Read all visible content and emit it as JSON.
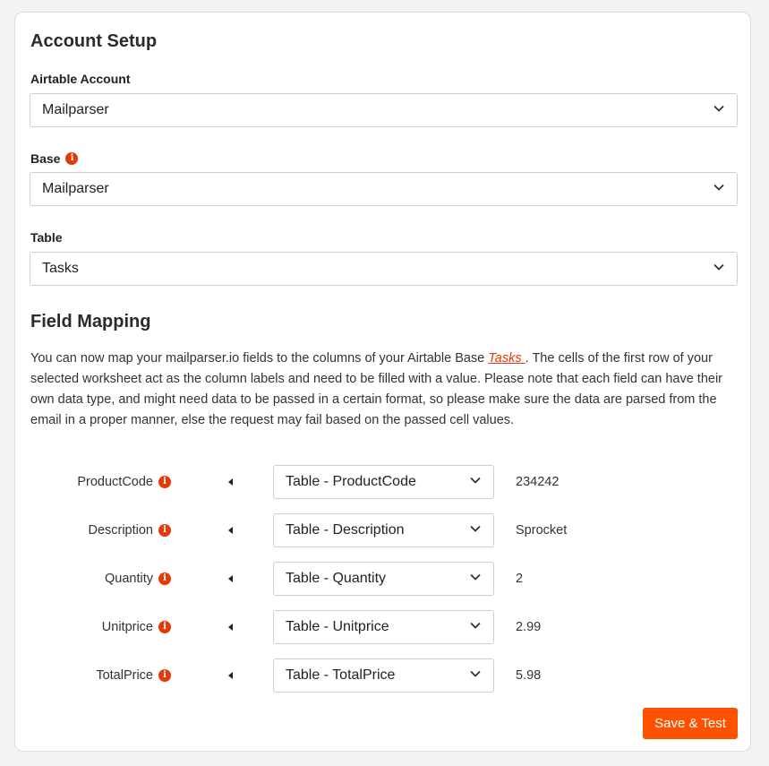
{
  "account_setup": {
    "title": "Account Setup",
    "airtable_account_label": "Airtable Account",
    "airtable_account_value": "Mailparser",
    "base_label": "Base",
    "base_value": "Mailparser",
    "table_label": "Table",
    "table_value": "Tasks"
  },
  "field_mapping": {
    "title": "Field Mapping",
    "desc_before": "You can now map your mailparser.io fields to the columns of your Airtable Base ",
    "desc_link": "Tasks ",
    "desc_after": ". The cells of the first row of your selected worksheet act as the column labels and need to be filled with a value. Please note that each field can have their own data type, and might need data to be passed in a certain format, so please make sure the data are parsed from the email in a proper manner, else the request may fail based on the passed cell values.",
    "rows": [
      {
        "field": "ProductCode",
        "column": "Table - ProductCode",
        "value": "234242"
      },
      {
        "field": "Description",
        "column": "Table - Description",
        "value": "Sprocket"
      },
      {
        "field": "Quantity",
        "column": "Table - Quantity",
        "value": "2"
      },
      {
        "field": "Unitprice",
        "column": "Table - Unitprice",
        "value": "2.99"
      },
      {
        "field": "TotalPrice",
        "column": "Table - TotalPrice",
        "value": "5.98"
      }
    ]
  },
  "actions": {
    "save_label": "Save & Test"
  },
  "colors": {
    "accent": "#ff5200",
    "info_icon": "#e33a0a"
  },
  "icons": {
    "info": "info-circle-icon",
    "dropdown": "chevron-down-icon",
    "mapping_arrow": "caret-left-icon"
  }
}
